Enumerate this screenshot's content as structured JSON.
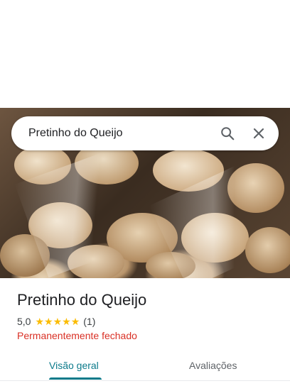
{
  "search": {
    "query": "Pretinho do Queijo"
  },
  "place": {
    "name": "Pretinho do Queijo",
    "rating": "5,0",
    "stars": [
      "★",
      "★",
      "★",
      "★",
      "★"
    ],
    "review_count": "(1)",
    "status": "Permanentemente fechado"
  },
  "tabs": [
    {
      "label": "Visão geral"
    },
    {
      "label": "Avaliações"
    }
  ],
  "colors": {
    "star": "#fbbc04",
    "status_closed": "#d93025",
    "active_tab": "#0b7a8a"
  },
  "icons": [
    "search-icon",
    "close-icon"
  ]
}
